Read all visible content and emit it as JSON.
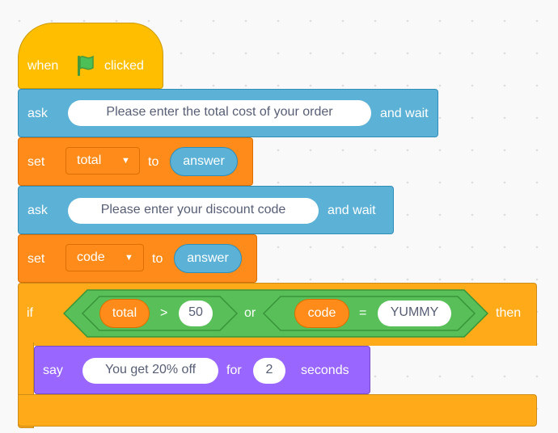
{
  "script": {
    "hat": {
      "when": "when",
      "flag_icon": "green-flag-icon",
      "clicked": "clicked"
    },
    "ask1": {
      "keyword": "ask",
      "question": "Please enter the total cost of your order",
      "suffix": "and wait"
    },
    "set1": {
      "keyword": "set",
      "variable": "total",
      "to": "to",
      "value": "answer"
    },
    "ask2": {
      "keyword": "ask",
      "question": "Please enter your discount code",
      "suffix": "and wait"
    },
    "set2": {
      "keyword": "set",
      "variable": "code",
      "to": "to",
      "value": "answer"
    },
    "if_block": {
      "keyword": "if",
      "then": "then",
      "condition": {
        "left": {
          "variable": "total",
          "operator": ">",
          "value": "50"
        },
        "joiner": "or",
        "right": {
          "variable": "code",
          "operator": "=",
          "value": "YUMMY"
        }
      }
    },
    "say": {
      "keyword": "say",
      "message": "You get 20% off",
      "for": "for",
      "duration": "2",
      "unit": "seconds"
    }
  },
  "colors": {
    "events": "#ffbf00",
    "sensing": "#5cb1d6",
    "variables": "#ff8c1a",
    "control": "#ffab19",
    "operators": "#59c059",
    "looks": "#9966ff",
    "flag": "#4cbf56"
  }
}
